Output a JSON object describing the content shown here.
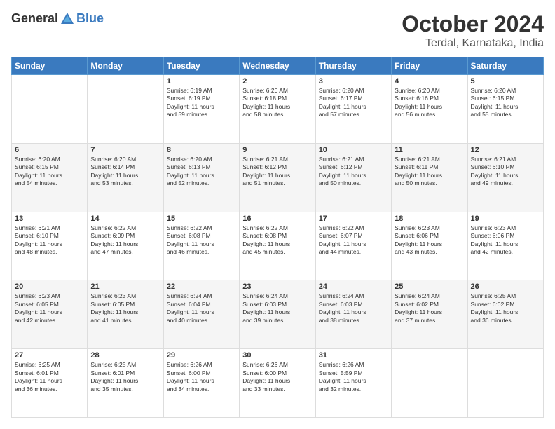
{
  "header": {
    "logo_line1": "General",
    "logo_line2": "Blue",
    "title": "October 2024",
    "location": "Terdal, Karnataka, India"
  },
  "weekdays": [
    "Sunday",
    "Monday",
    "Tuesday",
    "Wednesday",
    "Thursday",
    "Friday",
    "Saturday"
  ],
  "weeks": [
    [
      {
        "day": "",
        "info": ""
      },
      {
        "day": "",
        "info": ""
      },
      {
        "day": "1",
        "info": "Sunrise: 6:19 AM\nSunset: 6:19 PM\nDaylight: 11 hours\nand 59 minutes."
      },
      {
        "day": "2",
        "info": "Sunrise: 6:20 AM\nSunset: 6:18 PM\nDaylight: 11 hours\nand 58 minutes."
      },
      {
        "day": "3",
        "info": "Sunrise: 6:20 AM\nSunset: 6:17 PM\nDaylight: 11 hours\nand 57 minutes."
      },
      {
        "day": "4",
        "info": "Sunrise: 6:20 AM\nSunset: 6:16 PM\nDaylight: 11 hours\nand 56 minutes."
      },
      {
        "day": "5",
        "info": "Sunrise: 6:20 AM\nSunset: 6:15 PM\nDaylight: 11 hours\nand 55 minutes."
      }
    ],
    [
      {
        "day": "6",
        "info": "Sunrise: 6:20 AM\nSunset: 6:15 PM\nDaylight: 11 hours\nand 54 minutes."
      },
      {
        "day": "7",
        "info": "Sunrise: 6:20 AM\nSunset: 6:14 PM\nDaylight: 11 hours\nand 53 minutes."
      },
      {
        "day": "8",
        "info": "Sunrise: 6:20 AM\nSunset: 6:13 PM\nDaylight: 11 hours\nand 52 minutes."
      },
      {
        "day": "9",
        "info": "Sunrise: 6:21 AM\nSunset: 6:12 PM\nDaylight: 11 hours\nand 51 minutes."
      },
      {
        "day": "10",
        "info": "Sunrise: 6:21 AM\nSunset: 6:12 PM\nDaylight: 11 hours\nand 50 minutes."
      },
      {
        "day": "11",
        "info": "Sunrise: 6:21 AM\nSunset: 6:11 PM\nDaylight: 11 hours\nand 50 minutes."
      },
      {
        "day": "12",
        "info": "Sunrise: 6:21 AM\nSunset: 6:10 PM\nDaylight: 11 hours\nand 49 minutes."
      }
    ],
    [
      {
        "day": "13",
        "info": "Sunrise: 6:21 AM\nSunset: 6:10 PM\nDaylight: 11 hours\nand 48 minutes."
      },
      {
        "day": "14",
        "info": "Sunrise: 6:22 AM\nSunset: 6:09 PM\nDaylight: 11 hours\nand 47 minutes."
      },
      {
        "day": "15",
        "info": "Sunrise: 6:22 AM\nSunset: 6:08 PM\nDaylight: 11 hours\nand 46 minutes."
      },
      {
        "day": "16",
        "info": "Sunrise: 6:22 AM\nSunset: 6:08 PM\nDaylight: 11 hours\nand 45 minutes."
      },
      {
        "day": "17",
        "info": "Sunrise: 6:22 AM\nSunset: 6:07 PM\nDaylight: 11 hours\nand 44 minutes."
      },
      {
        "day": "18",
        "info": "Sunrise: 6:23 AM\nSunset: 6:06 PM\nDaylight: 11 hours\nand 43 minutes."
      },
      {
        "day": "19",
        "info": "Sunrise: 6:23 AM\nSunset: 6:06 PM\nDaylight: 11 hours\nand 42 minutes."
      }
    ],
    [
      {
        "day": "20",
        "info": "Sunrise: 6:23 AM\nSunset: 6:05 PM\nDaylight: 11 hours\nand 42 minutes."
      },
      {
        "day": "21",
        "info": "Sunrise: 6:23 AM\nSunset: 6:05 PM\nDaylight: 11 hours\nand 41 minutes."
      },
      {
        "day": "22",
        "info": "Sunrise: 6:24 AM\nSunset: 6:04 PM\nDaylight: 11 hours\nand 40 minutes."
      },
      {
        "day": "23",
        "info": "Sunrise: 6:24 AM\nSunset: 6:03 PM\nDaylight: 11 hours\nand 39 minutes."
      },
      {
        "day": "24",
        "info": "Sunrise: 6:24 AM\nSunset: 6:03 PM\nDaylight: 11 hours\nand 38 minutes."
      },
      {
        "day": "25",
        "info": "Sunrise: 6:24 AM\nSunset: 6:02 PM\nDaylight: 11 hours\nand 37 minutes."
      },
      {
        "day": "26",
        "info": "Sunrise: 6:25 AM\nSunset: 6:02 PM\nDaylight: 11 hours\nand 36 minutes."
      }
    ],
    [
      {
        "day": "27",
        "info": "Sunrise: 6:25 AM\nSunset: 6:01 PM\nDaylight: 11 hours\nand 36 minutes."
      },
      {
        "day": "28",
        "info": "Sunrise: 6:25 AM\nSunset: 6:01 PM\nDaylight: 11 hours\nand 35 minutes."
      },
      {
        "day": "29",
        "info": "Sunrise: 6:26 AM\nSunset: 6:00 PM\nDaylight: 11 hours\nand 34 minutes."
      },
      {
        "day": "30",
        "info": "Sunrise: 6:26 AM\nSunset: 6:00 PM\nDaylight: 11 hours\nand 33 minutes."
      },
      {
        "day": "31",
        "info": "Sunrise: 6:26 AM\nSunset: 5:59 PM\nDaylight: 11 hours\nand 32 minutes."
      },
      {
        "day": "",
        "info": ""
      },
      {
        "day": "",
        "info": ""
      }
    ]
  ]
}
